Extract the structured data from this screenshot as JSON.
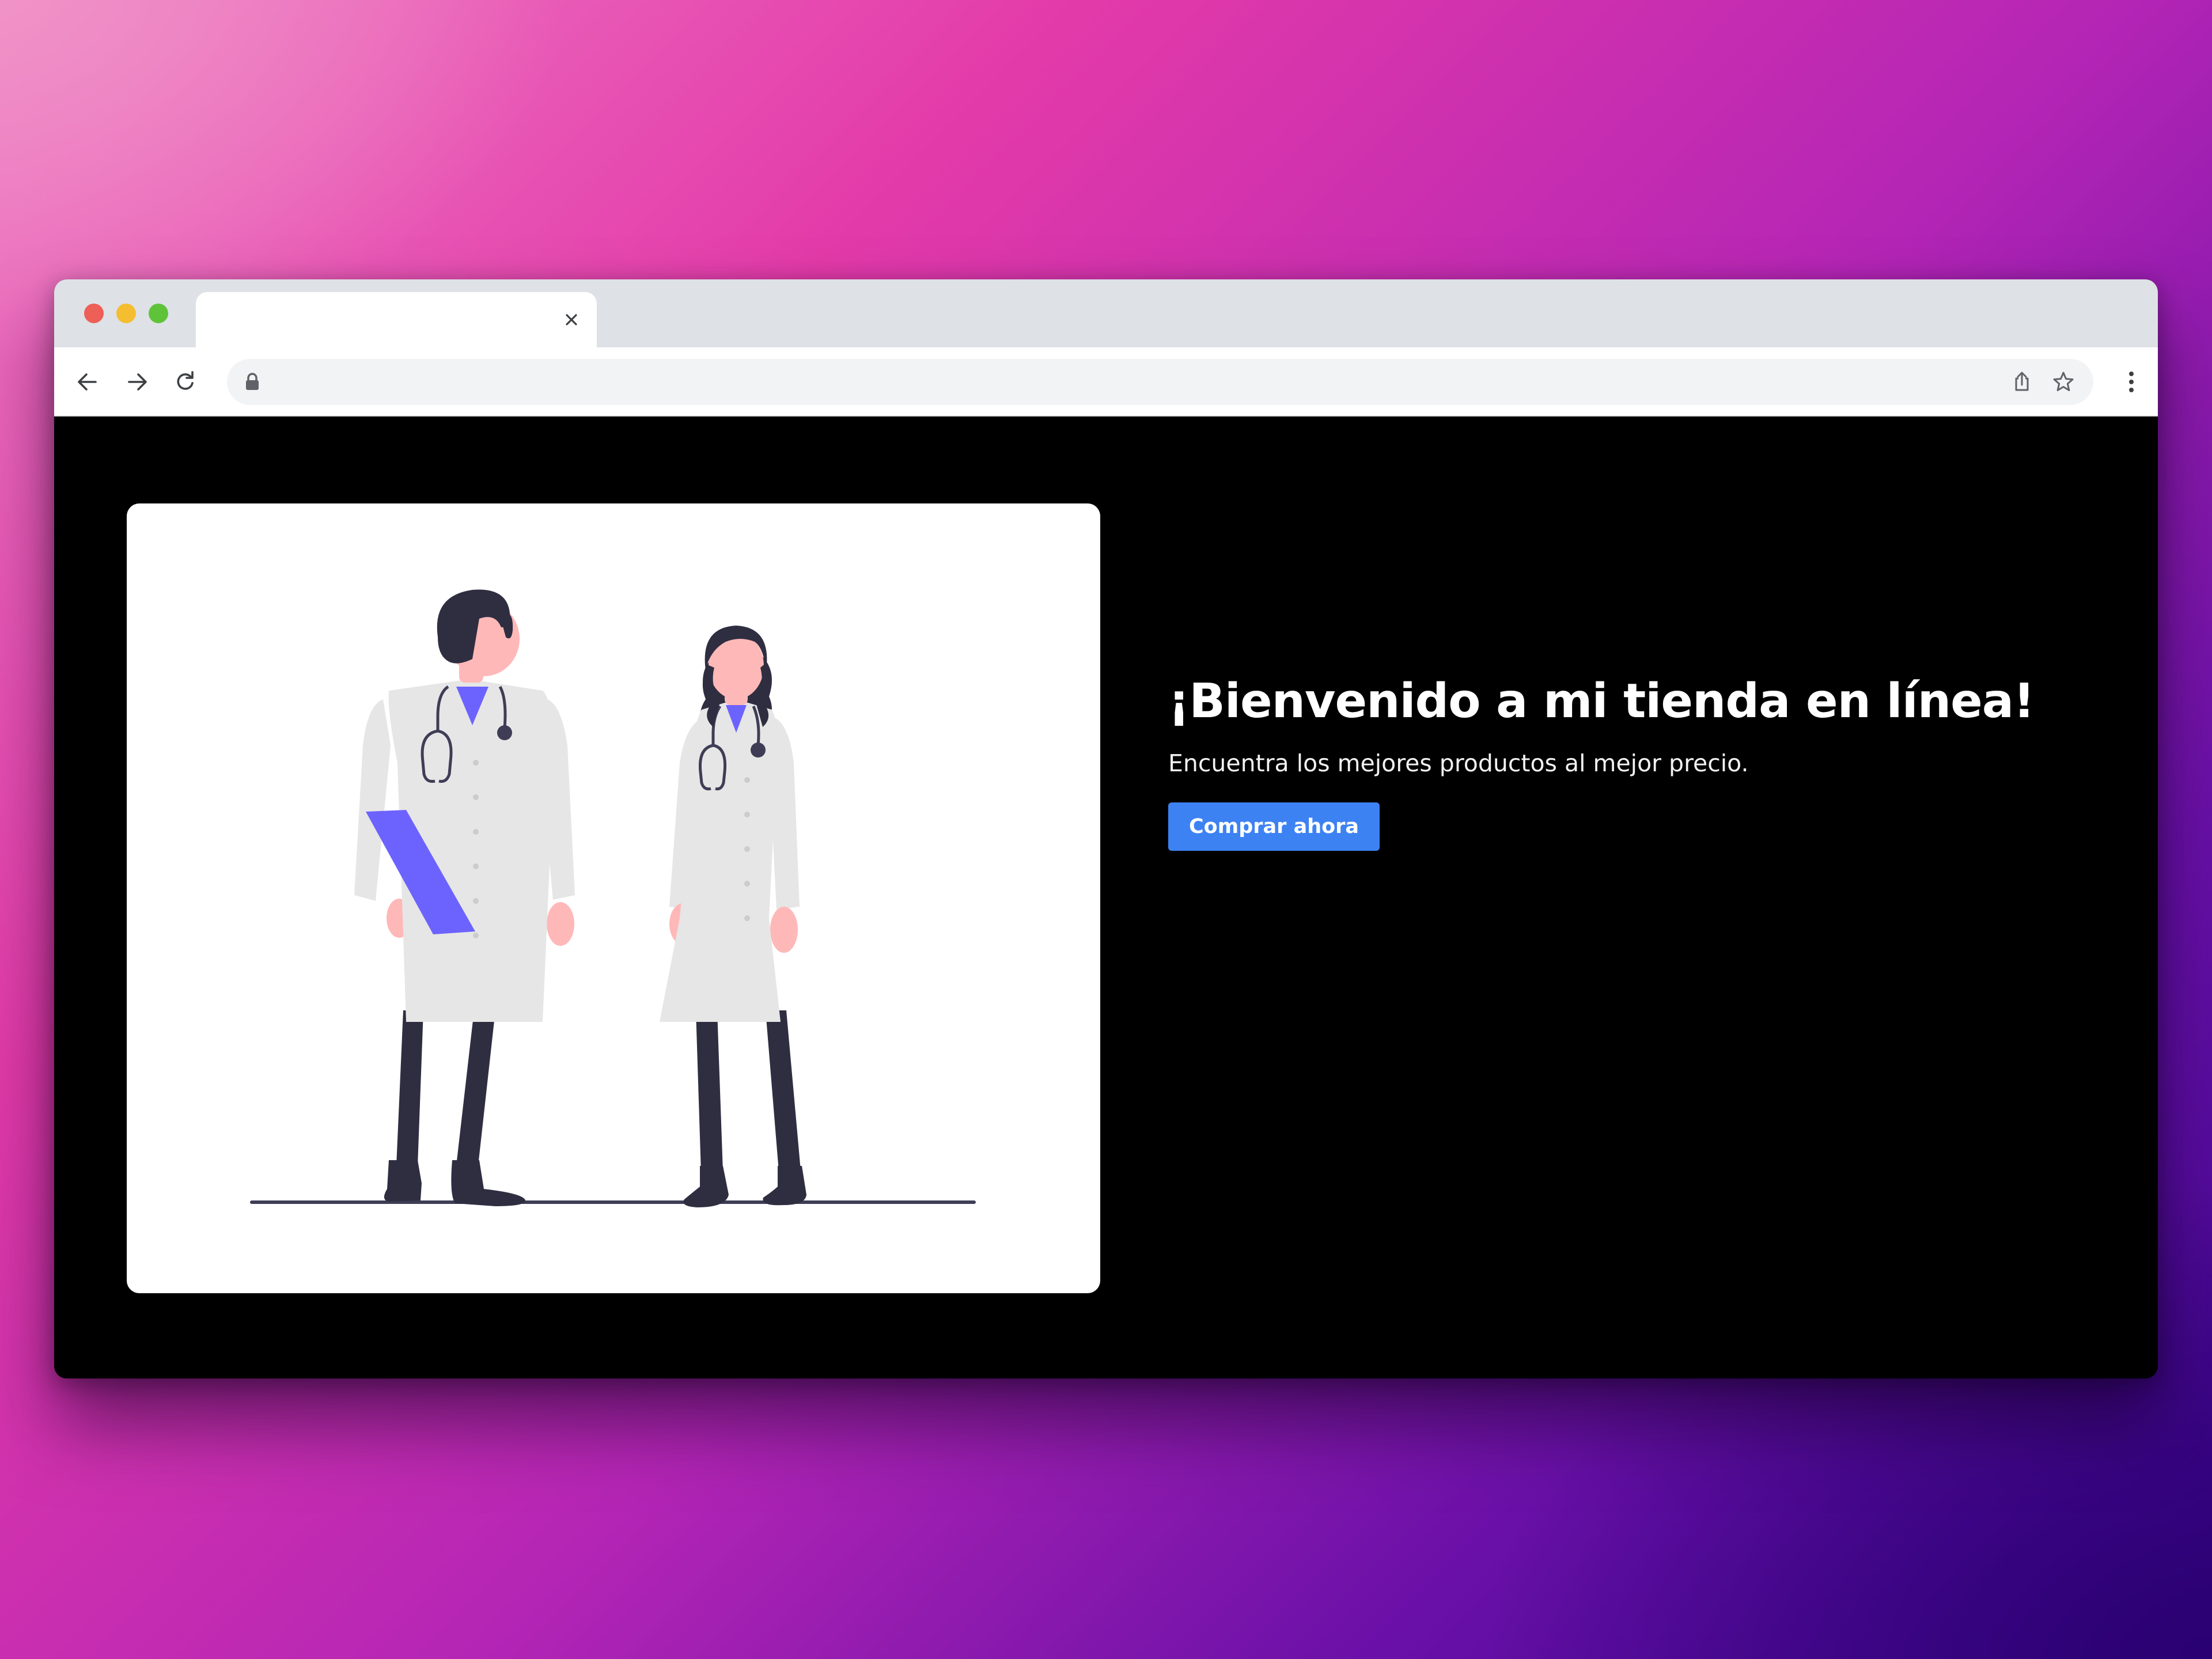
{
  "browser": {
    "tab": {
      "title": "",
      "close_icon": "close-icon"
    },
    "toolbar": {
      "back_icon": "arrow-left-icon",
      "forward_icon": "arrow-right-icon",
      "reload_icon": "reload-icon",
      "url": "",
      "lock_icon": "lock-icon",
      "share_icon": "share-icon",
      "bookmark_icon": "star-icon",
      "menu_icon": "kebab-menu-icon"
    },
    "traffic_lights": [
      "#ed5f57",
      "#f5bd30",
      "#5fc339"
    ]
  },
  "hero": {
    "title": "¡Bienvenido a mi tienda en línea!",
    "subtitle": "Encuentra los mejores productos al mejor precio.",
    "cta_label": "Comprar ahora",
    "illustration": "two-doctors-illustration"
  },
  "colors": {
    "accent": "#3d82f3",
    "page_background": "#000000",
    "illustration_accent": "#6c63ff"
  }
}
